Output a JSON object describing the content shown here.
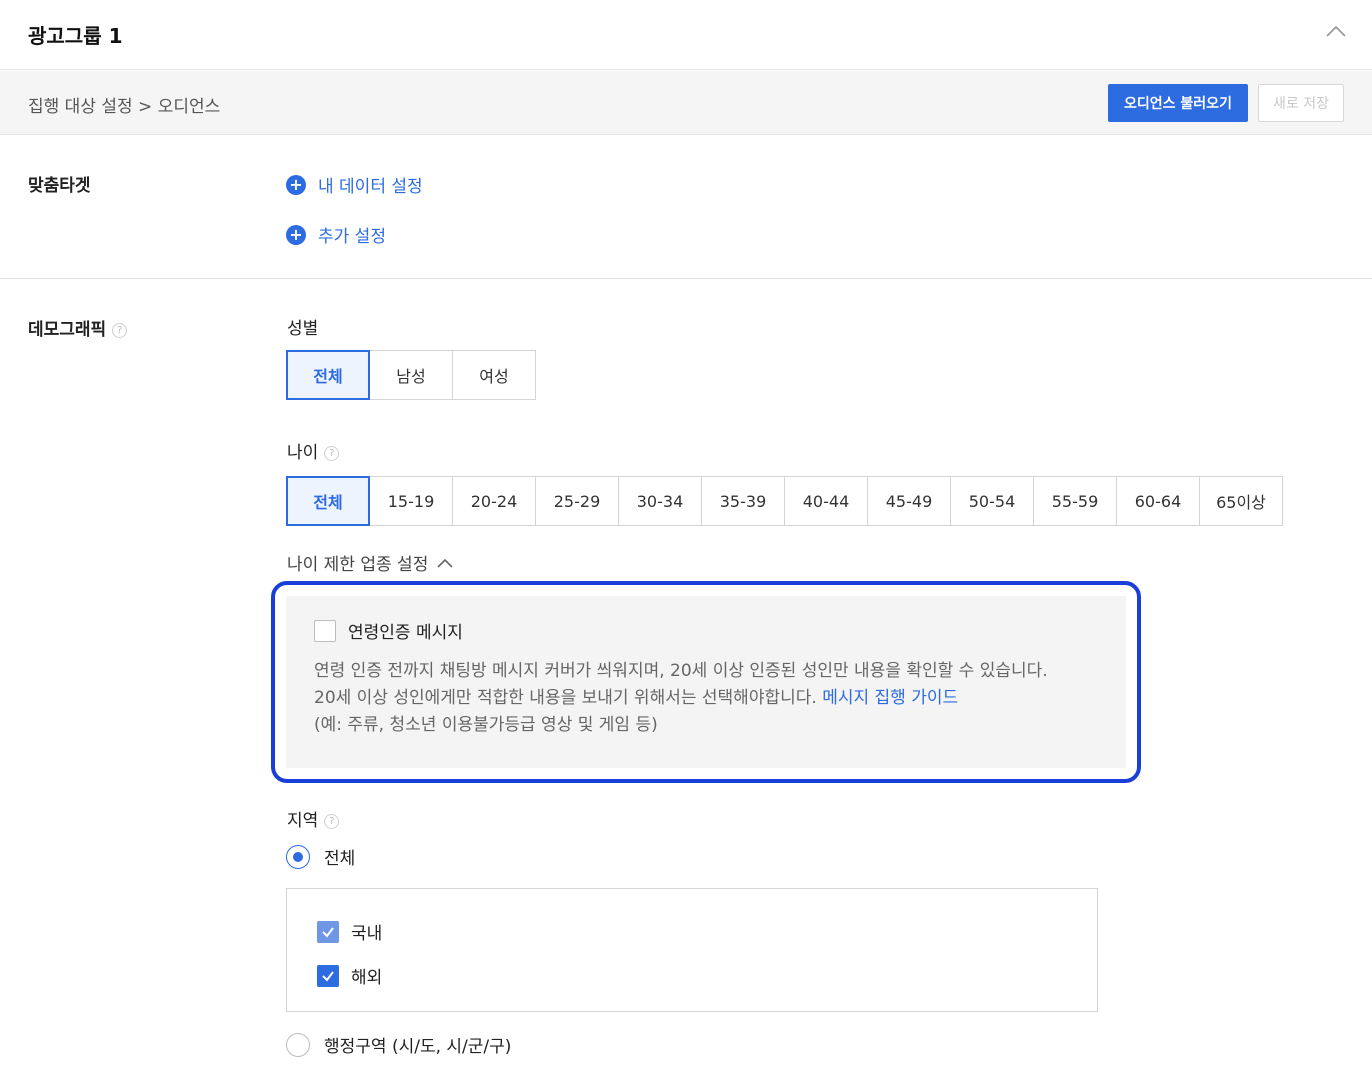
{
  "header": {
    "title": "광고그룹 1"
  },
  "subbar": {
    "breadcrumb": "집행 대상 설정 > 오디언스",
    "load_audience_label": "오디언스 불러오기",
    "save_new_label": "새로 저장"
  },
  "custom_target": {
    "label": "맞춤타겟",
    "links": [
      "내 데이터 설정",
      "추가 설정"
    ]
  },
  "demographic": {
    "label": "데모그래픽",
    "help": "?",
    "gender": {
      "label": "성별",
      "options": [
        "전체",
        "남성",
        "여성"
      ],
      "selected": "전체"
    },
    "age": {
      "label": "나이",
      "options": [
        "전체",
        "15-19",
        "20-24",
        "25-29",
        "30-34",
        "35-39",
        "40-44",
        "45-49",
        "50-54",
        "55-59",
        "60-64",
        "65이상"
      ],
      "selected": "전체"
    },
    "age_limit": {
      "toggle_label": "나이 제한 업종 설정",
      "checkbox_label": "연령인증 메시지",
      "desc_line1": "연령 인증 전까지 채팅방 메시지 커버가 씌워지며, 20세 이상 인증된 성인만 내용을 확인할 수 있습니다.",
      "desc_line2": "20세 이상 성인에게만 적합한 내용을 보내기 위해서는 선택해야합니다.",
      "guide_link": "메시지 집행 가이드",
      "desc_line3": "(예: 주류, 청소년 이용불가등급 영상 및 게임 등)"
    },
    "region": {
      "label": "지역",
      "all_label": "전체",
      "domestic_label": "국내",
      "overseas_label": "해외",
      "admin_label": "행정구역 (시/도, 시/군/구)"
    }
  },
  "colors": {
    "accent": "#2d6be0",
    "highlight": "#1a3fd9"
  }
}
